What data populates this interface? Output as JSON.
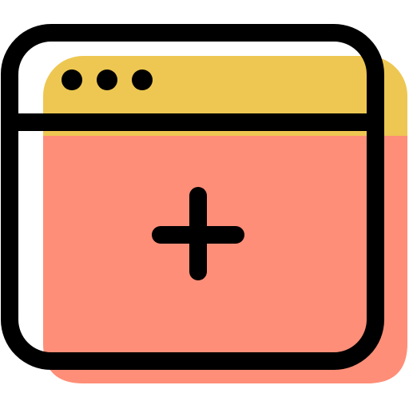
{
  "icon": {
    "name": "new-browser-window-icon",
    "colors": {
      "outline": "#000000",
      "title_bar_fill": "#EDC752",
      "body_fill": "#FF8E78",
      "background": "#FFFFFF"
    },
    "parts": {
      "window_frame": "window-frame",
      "title_bar": "title-bar",
      "dots": [
        "dot-1",
        "dot-2",
        "dot-3"
      ],
      "plus": "plus-icon"
    }
  }
}
